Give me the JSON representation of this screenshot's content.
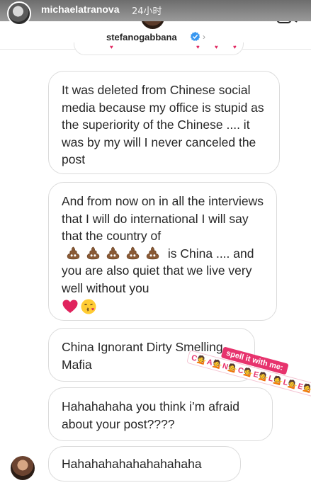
{
  "story": {
    "username": "michaelatranova",
    "time": "24小时"
  },
  "header": {
    "contact_name": "stefanogabbana",
    "verified": true,
    "icons": [
      "verified-badge-icon",
      "chevron-right-icon",
      "video-call-icon"
    ]
  },
  "messages": [
    {
      "text": "It was deleted from Chinese social media because my office is stupid as the superiority of the Chinese .... it was by my will I never canceled the post"
    },
    {
      "text_before": "And from now on in all the interviews that I will do international I will say that the country of",
      "emoji_poo_count": 5,
      "text_after": "is China .... and you are also quiet that we live very well without you",
      "trailing_emojis": [
        "red-heart-icon",
        "face-blowing-kiss-icon"
      ]
    },
    {
      "text": "China Ignorant Dirty Smelling Mafia"
    },
    {
      "text": "Hahahahaha you think i’m afraid about your post????"
    },
    {
      "text": "Hahahahahahahahahaha"
    }
  ],
  "sticker": {
    "top": "spell it with me:",
    "bottom": "C💁A💁N💁C💁E💁L💁L💁E💁D"
  },
  "colors": {
    "bubble_border": "#dbdbdb",
    "text": "#262626",
    "sticker_pink": "#e7336d",
    "verified_blue": "#3897f0"
  }
}
